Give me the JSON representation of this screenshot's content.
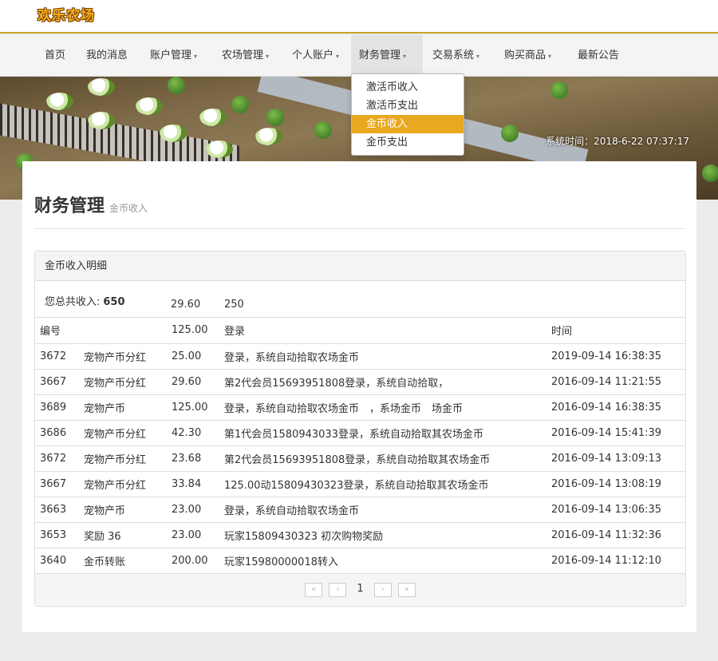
{
  "header": {
    "logo_text": "欢乐农场"
  },
  "nav": {
    "items": [
      {
        "label": "首页",
        "caret": ""
      },
      {
        "label": "我的消息",
        "caret": ""
      },
      {
        "label": "账户管理",
        "caret": "▾"
      },
      {
        "label": "农场管理",
        "caret": "▾"
      },
      {
        "label": "个人账户",
        "caret": "▾"
      },
      {
        "label": "财务管理",
        "caret": "▾"
      },
      {
        "label": "交易系统",
        "caret": "▾"
      },
      {
        "label": "购买商品",
        "caret": "▾"
      },
      {
        "label": "最新公告",
        "caret": ""
      }
    ],
    "active_label": "财务管理"
  },
  "dropdown": {
    "items": [
      "激活币收入",
      "激活币支出",
      "金币收入",
      "金币支出"
    ],
    "active_item": "金币收入"
  },
  "banner": {
    "system_time": "系统时间：2018-6-22 07:37:17"
  },
  "page": {
    "title": "财务管理",
    "subtitle": "金币收入"
  },
  "panel": {
    "heading": "金币收入明细",
    "summary_label": "您总共收入:",
    "summary_value": "650",
    "summary_extra_1": "29.60",
    "summary_extra_2": "250"
  },
  "table": {
    "headers": {
      "id": "编号",
      "type": "",
      "amount": "125.00",
      "desc": "登录",
      "time": "时间"
    },
    "rows": [
      {
        "id": "3672",
        "type": "宠物产币分红",
        "amount": "25.00",
        "desc": "登录，系统自动拾取农场金币",
        "time": "2019-09-14 16:38:35"
      },
      {
        "id": "3667",
        "type": "宠物产币分红",
        "amount": "29.60",
        "desc": "第2代会员15693951808登录，系统自动拾取，",
        "time": "2016-09-14 11:21:55"
      },
      {
        "id": "3689",
        "type": "宠物产币",
        "amount": "125.00",
        "desc": "登录，系统自动拾取农场金币　，系场金币　场金币",
        "time": "2016-09-14 16:38:35"
      },
      {
        "id": "3686",
        "type": "宠物产币分红",
        "amount": "42.30",
        "desc": "第1代会员1580943033登录，系统自动拾取其农场金币",
        "time": "2016-09-14 15:41:39"
      },
      {
        "id": "3672",
        "type": "宠物产币分红",
        "amount": "23.68",
        "desc": "第2代会员15693951808登录，系统自动拾取其农场金币",
        "time": "2016-09-14 13:09:13"
      },
      {
        "id": "3667",
        "type": "宠物产币分红",
        "amount": "33.84",
        "desc": "125.00动15809430323登录，系统自动拾取其农场金币",
        "time": "2016-09-14 13:08:19"
      },
      {
        "id": "3663",
        "type": "宠物产币",
        "amount": "23.00",
        "desc": "登录，系统自动拾取农场金币",
        "time": "2016-09-14 13:06:35"
      },
      {
        "id": "3653",
        "type": "奖励 36",
        "amount": "23.00",
        "desc": "玩家15809430323 初次购物奖励",
        "time": "2016-09-14 11:32:36"
      },
      {
        "id": "3640",
        "type": "金币转账",
        "amount": "200.00",
        "desc": "玩家15980000018转入",
        "time": "2016-09-14 11:12:10"
      }
    ]
  },
  "pagination": {
    "first": "«",
    "prev": "‹",
    "page": "1",
    "next": "›",
    "last": "»"
  }
}
